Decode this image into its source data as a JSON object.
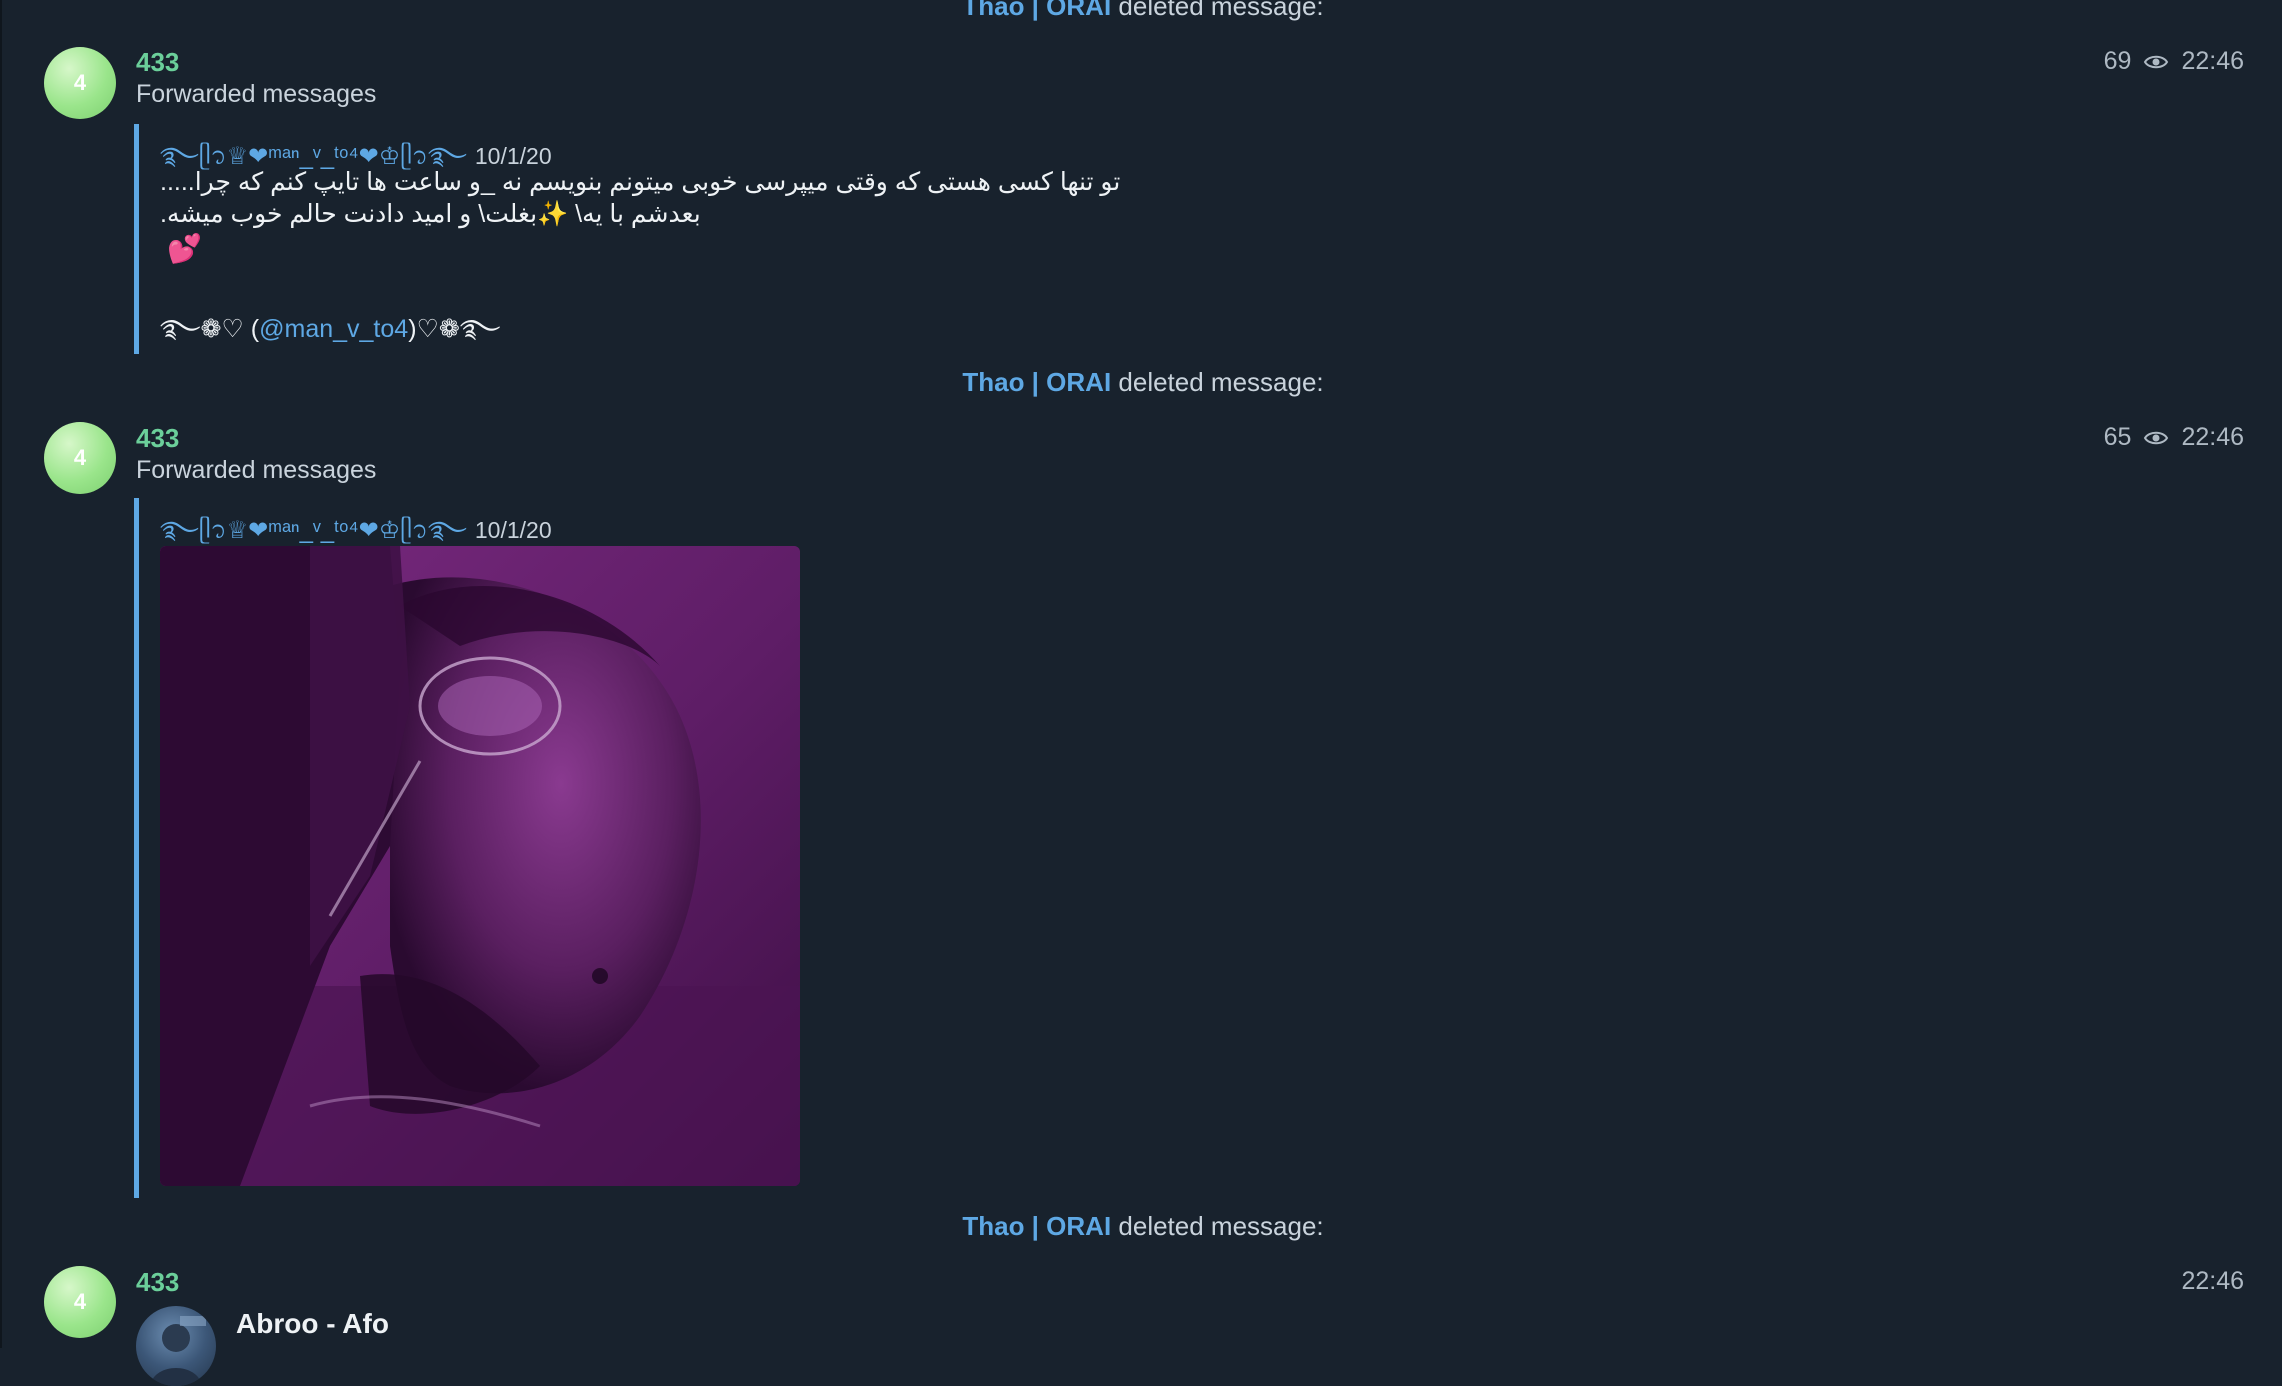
{
  "service_messages": [
    {
      "actor": "Thao | ORAI",
      "text": " deleted message:"
    },
    {
      "actor": "Thao | ORAI",
      "text": " deleted message:"
    },
    {
      "actor": "Thao | ORAI",
      "text": " deleted message:"
    }
  ],
  "messages": [
    {
      "avatar_initial": "4",
      "sender": "433",
      "views": "69",
      "time": "22:46",
      "forwarded_label": "Forwarded messages",
      "quote": {
        "name": "࿐ᥫ᭡♕❤︎ᵐᵃⁿ_ᵛ_ᵗᵒ⁴❤︎♔ᥫ᭡࿐",
        "date": "10/1/20",
        "line1": "تو تنها کسی هستی که وقتی میپرسی خوبی میتونم بنویسم نه _و ساعت ها تایپ کنم که چرا.....",
        "line2": "بعدشم با یه\\ ✨بغلت\\ و امید دادنت حالم خوب میشه.",
        "emoji": "💕",
        "sig_pre": "࿐❁♡ (",
        "sig_mention": "@man_v_to4",
        "sig_post": ")♡❁࿐"
      }
    },
    {
      "avatar_initial": "4",
      "sender": "433",
      "views": "65",
      "time": "22:46",
      "forwarded_label": "Forwarded messages",
      "quote": {
        "name": "࿐ᥫ᭡♕❤︎ᵐᵃⁿ_ᵛ_ᵗᵒ⁴❤︎♔ᥫ᭡࿐",
        "date": "10/1/20"
      }
    },
    {
      "avatar_initial": "4",
      "sender": "433",
      "time": "22:46",
      "audio_title": "Abroo - Afo"
    }
  ],
  "colors": {
    "background": "#18222d",
    "accent": "#5ea8e4",
    "sender": "#6bcf9a",
    "photo_tint": "#6a1f6f"
  }
}
